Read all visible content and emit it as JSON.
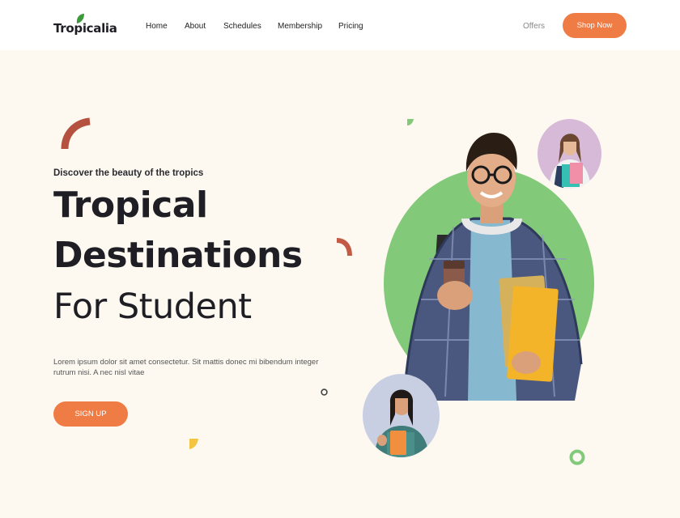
{
  "header": {
    "logo": "Tropicalia",
    "nav": [
      "Home",
      "About",
      "Schedules",
      "Membership",
      "Pricing"
    ],
    "offers": "Offers",
    "shop_button": "Shop Now"
  },
  "hero": {
    "tagline": "Discover the beauty of the tropics",
    "title_line1": "Tropical",
    "title_line2": "Destinations",
    "title_line3": "For Student",
    "description": "Lorem ipsum dolor sit amet consectetur. Sit mattis donec mi bibendum integer rutrum nisi. A nec nisl vitae",
    "signup_button": "SIGN UP"
  },
  "colors": {
    "accent": "#f07c45",
    "green": "#82c97a",
    "brick": "#b5513f",
    "yellow": "#f4c542",
    "background": "#fdf9f1"
  }
}
